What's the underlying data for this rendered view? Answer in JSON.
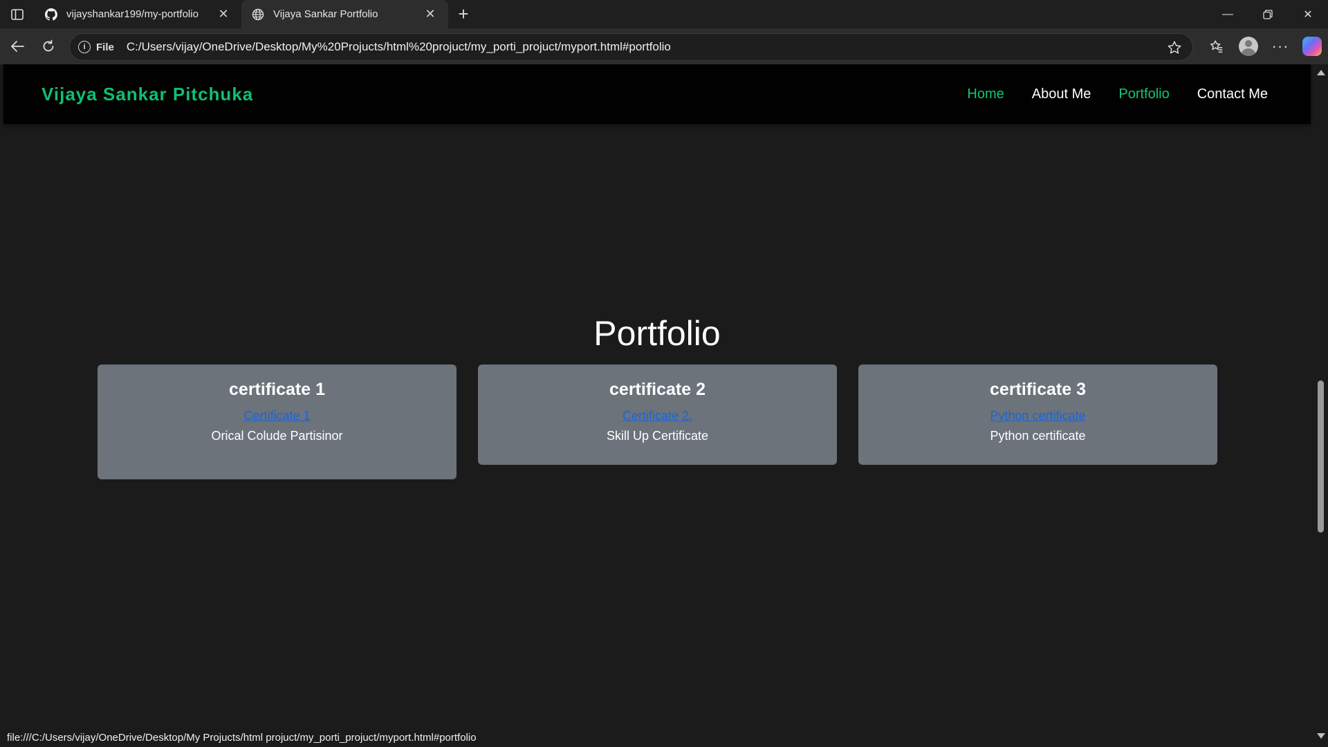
{
  "browser": {
    "tabs": [
      {
        "title": "vijayshankar199/my-portfolio",
        "icon": "github-icon",
        "active": false
      },
      {
        "title": "Vijaya Sankar Portfolio",
        "icon": "globe-icon",
        "active": true
      }
    ],
    "address_label": "File",
    "url": "C:/Users/vijay/OneDrive/Desktop/My%20Projucts/html%20projuct/my_porti_projuct/myport.html#portfolio",
    "status_url": "file:///C:/Users/vijay/OneDrive/Desktop/My Projucts/html projuct/my_porti_projuct/myport.html#portfolio"
  },
  "site": {
    "brand": "Vijaya Sankar Pitchuka",
    "nav": [
      {
        "label": "Home",
        "color": "#12c76f"
      },
      {
        "label": "About Me",
        "color": "#ffffff"
      },
      {
        "label": "Portfolio",
        "color": "#12c76f"
      },
      {
        "label": "Contact Me",
        "color": "#ffffff"
      }
    ]
  },
  "portfolio": {
    "title": "Portfolio",
    "cards": [
      {
        "heading": "certificate 1",
        "link": "Certificate 1",
        "description": "Orical Colude Partisinor"
      },
      {
        "heading": "certificate 2",
        "link": "Certificate 2.",
        "description": "Skill Up Certificate"
      },
      {
        "heading": "certificate 3",
        "link": "Python certificate",
        "description": "Python certificate"
      }
    ]
  },
  "colors": {
    "brand": "#0fbf70",
    "card_bg": "#6c737b",
    "link": "#1565e0",
    "page_bg": "#1b1b1b"
  }
}
